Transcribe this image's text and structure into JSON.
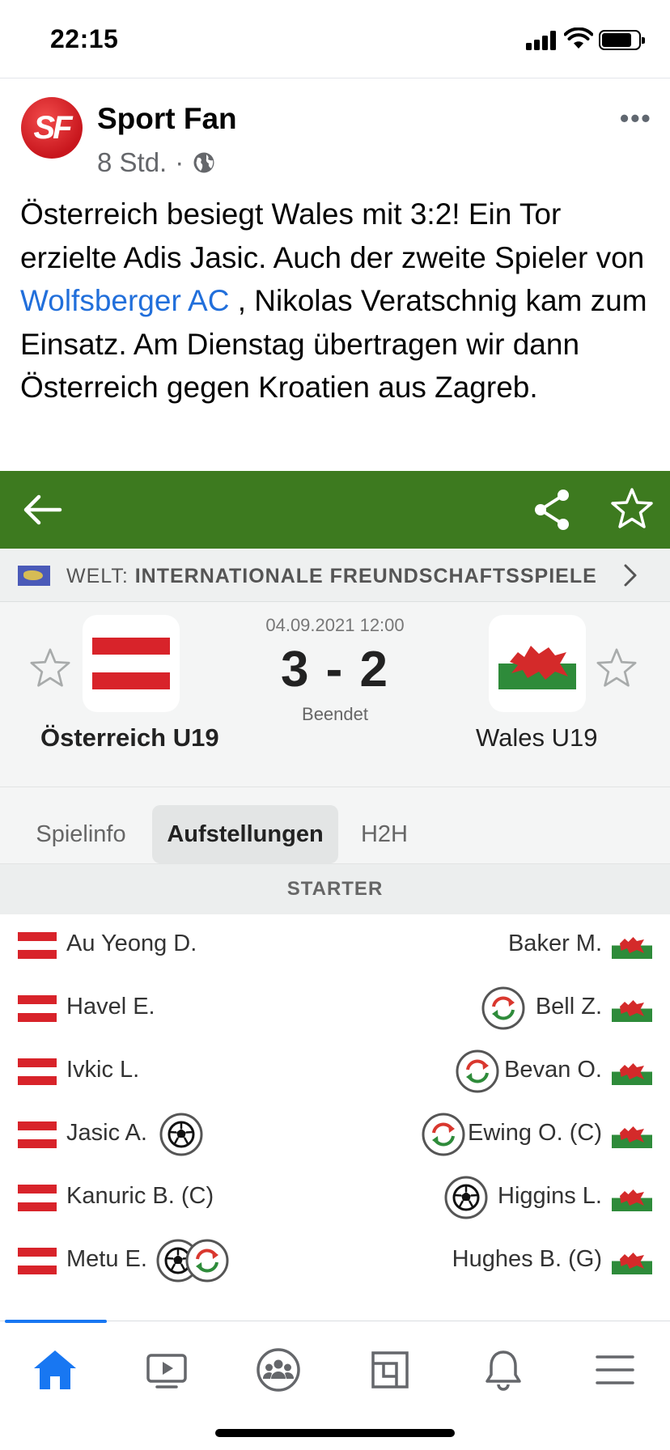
{
  "status_bar": {
    "time": "22:15"
  },
  "post": {
    "avatar_text": "SF",
    "page_name": "Sport Fan",
    "time_ago": "8 Std.",
    "separator": "·",
    "more_label": "•••",
    "text_part1": "Österreich besiegt Wales mit 3:2! Ein Tor erzielte Adis Jasic. Auch der zweite Spieler von ",
    "link_text": "Wolfsberger AC",
    "text_part2": " , Nikolas Veratschnig kam zum Einsatz. Am Dienstag übertragen wir dann Österreich gegen Kroatien aus Zagreb."
  },
  "match": {
    "colors": {
      "header_green": "#3d7a1f",
      "link_blue": "#216fdb",
      "accent_blue": "#1877f2"
    },
    "competition_prefix": "WELT:",
    "competition_name": "INTERNATIONALE FREUNDSCHAFTSSPIELE",
    "datetime": "04.09.2021 12:00",
    "score": "3 - 2",
    "status": "Beendet",
    "home_team": "Österreich U19",
    "away_team": "Wales U19",
    "tabs": [
      {
        "label": "Spielinfo",
        "active": false
      },
      {
        "label": "Aufstellungen",
        "active": true
      },
      {
        "label": "H2H",
        "active": false
      }
    ],
    "section_label": "STARTER",
    "home_players": [
      {
        "name": "Au Yeong D.",
        "icons": []
      },
      {
        "name": "Havel E.",
        "icons": []
      },
      {
        "name": "Ivkic L.",
        "icons": []
      },
      {
        "name": "Jasic A.",
        "icons": [
          "goal-icon"
        ]
      },
      {
        "name": "Kanuric B. (C)",
        "icons": []
      },
      {
        "name": "Metu E.",
        "icons": [
          "goal-icon",
          "substitution-icon"
        ]
      }
    ],
    "away_players": [
      {
        "name": "Baker M.",
        "icons": []
      },
      {
        "name": "Bell Z.",
        "icons": [
          "substitution-icon"
        ]
      },
      {
        "name": "Bevan O.",
        "icons": [
          "substitution-icon"
        ]
      },
      {
        "name": "Ewing O. (C)",
        "icons": [
          "substitution-icon"
        ]
      },
      {
        "name": "Higgins L.",
        "icons": [
          "goal-icon"
        ]
      },
      {
        "name": "Hughes B. (G)",
        "icons": []
      }
    ]
  },
  "bottom_nav": {
    "items": [
      "home-icon",
      "watch-icon",
      "groups-icon",
      "pages-icon",
      "notifications-icon",
      "menu-icon"
    ],
    "active": "home-icon"
  }
}
